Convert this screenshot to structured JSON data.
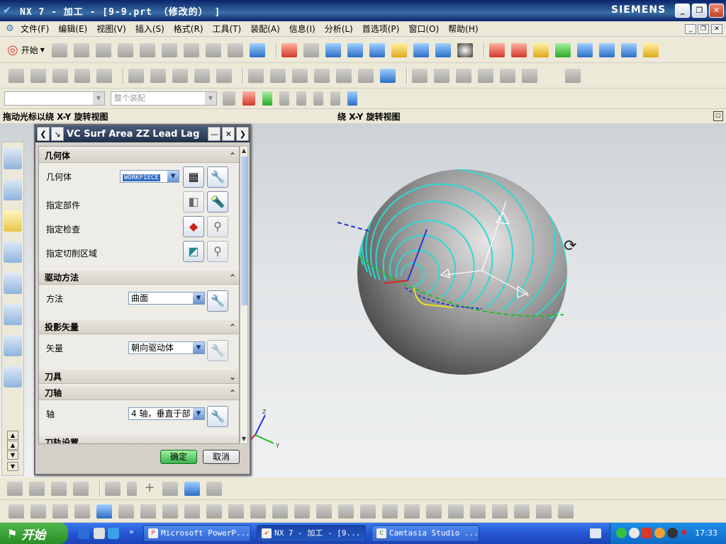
{
  "window": {
    "title": "NX 7 - 加工 - [9-9.prt （修改的） ]",
    "brand": "SIEMENS",
    "controls": [
      "_",
      "❐",
      "✕"
    ]
  },
  "menubar": {
    "items": [
      "文件(F)",
      "编辑(E)",
      "视图(V)",
      "插入(S)",
      "格式(R)",
      "工具(T)",
      "装配(A)",
      "信息(I)",
      "分析(L)",
      "首选项(P)",
      "窗口(O)",
      "帮助(H)"
    ]
  },
  "toolbar": {
    "start_label": "开始",
    "filter_placeholder": "",
    "assembly_scope": "整个装配"
  },
  "cue_line": {
    "cue": "拖动光标以绕 X-Y 旋转视图",
    "status": "绕 X-Y 旋转视图"
  },
  "dialog": {
    "title": "VC Surf Area ZZ Lead Lag",
    "sections": {
      "geometry": {
        "header": "几何体",
        "geometry_label": "几何体",
        "geometry_value": "WORKPIECE",
        "part_label": "指定部件",
        "check_label": "指定检查",
        "cut_region_label": "指定切削区域"
      },
      "drive": {
        "header": "驱动方法",
        "method_label": "方法",
        "method_value": "曲面"
      },
      "projection": {
        "header": "投影矢量",
        "vector_label": "矢量",
        "vector_value": "朝向驱动体"
      },
      "tool": {
        "header": "刀具"
      },
      "tool_axis": {
        "header": "刀轴",
        "axis_label": "轴",
        "axis_value": "4 轴，垂直于部"
      },
      "partial": {
        "header": "刀轨设置"
      }
    },
    "ok_label": "确定",
    "cancel_label": "取消"
  },
  "viewport": {
    "triad_labels": {
      "x": "X",
      "y": "Y",
      "z": "Z"
    },
    "background_top": "#ccd2d6",
    "toolpath_color": "#2fd9d2"
  },
  "taskbar": {
    "start_label": "开始",
    "tasks": [
      "Microsoft PowerP...",
      "NX 7 - 加工 - [9...",
      "Camtasia Studio ..."
    ],
    "clock": "17:33"
  }
}
